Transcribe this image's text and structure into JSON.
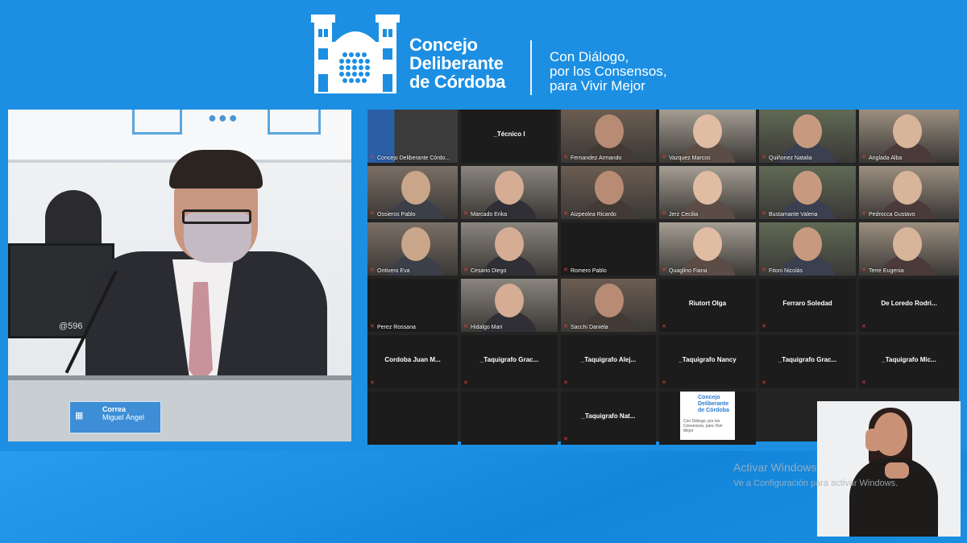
{
  "header": {
    "org_name_line1": "Concejo",
    "org_name_line2": "Deliberante",
    "org_name_line3": "de Córdoba",
    "slogan_line1": "Con Diálogo,",
    "slogan_line2": "por los Consensos,",
    "slogan_line3": "para Vivir Mejor"
  },
  "speaker": {
    "nameplate_surname": "Correa",
    "nameplate_given": "Miguel Ángel",
    "monitor_text": "@596"
  },
  "grid": {
    "tiles": [
      {
        "label": "Concejo Deliberante Córdo...",
        "kind": "screen"
      },
      {
        "label": "_Técnico I",
        "kind": "name"
      },
      {
        "label": "Fernandez Armando",
        "kind": "video"
      },
      {
        "label": "Vazquez Marcos",
        "kind": "video"
      },
      {
        "label": "Quiñonez Natalia",
        "kind": "video"
      },
      {
        "label": "Anglada Alba",
        "kind": "video"
      },
      {
        "label": "Ossieros Pablo",
        "kind": "video"
      },
      {
        "label": "Marcado Erika",
        "kind": "video"
      },
      {
        "label": "Aizpeolea Ricardo",
        "kind": "video"
      },
      {
        "label": "Jerz Cecilia",
        "kind": "video"
      },
      {
        "label": "Bustamante Valeria",
        "kind": "video"
      },
      {
        "label": "Pedrocca Gustavo",
        "kind": "video"
      },
      {
        "label": "Ontivero Eva",
        "kind": "video"
      },
      {
        "label": "Cesario Diego",
        "kind": "video"
      },
      {
        "label": "Romero Pablo",
        "kind": "blank"
      },
      {
        "label": "Quaglino Fiana",
        "kind": "video"
      },
      {
        "label": "Fitoni Nicolás",
        "kind": "video"
      },
      {
        "label": "Terre Eugenia",
        "kind": "video"
      },
      {
        "label": "Perez Rossana",
        "kind": "blank"
      },
      {
        "label": "Hidalgo Mari",
        "kind": "video"
      },
      {
        "label": "Sacchi Daniela",
        "kind": "video"
      },
      {
        "label": "Riutort Olga",
        "kind": "name"
      },
      {
        "label": "Ferraro Soledad",
        "kind": "name"
      },
      {
        "label": "De Loredo Rodri...",
        "kind": "name"
      },
      {
        "label": "Cordoba Juan M...",
        "kind": "name"
      },
      {
        "label": "_Taquigrafo Grac...",
        "kind": "name"
      },
      {
        "label": "_Taquigrafo Alej...",
        "kind": "name"
      },
      {
        "label": "_Taquigrafo Nancy",
        "kind": "name"
      },
      {
        "label": "_Taquigrafo Grac...",
        "kind": "name"
      },
      {
        "label": "_Taquigrafo Mic...",
        "kind": "name"
      },
      {
        "label": "",
        "kind": "empty"
      },
      {
        "label": "",
        "kind": "empty"
      },
      {
        "label": "_Taquigrafo Nat...",
        "kind": "name"
      },
      {
        "label": "",
        "kind": "logo"
      }
    ],
    "logo_tile": {
      "line1": "Concejo",
      "line2": "Deliberante",
      "line3": "de Córdoba",
      "slogan": "Con Diálogo, por los Consensos, para Vivir Mejor"
    }
  },
  "watermark": {
    "line1": "Activar Windows",
    "line2": "Ve a Configuración para activar Windows."
  },
  "colors": {
    "background": "#1c8fe3",
    "grid_bg": "#242424",
    "muted_mic": "#e24141"
  }
}
